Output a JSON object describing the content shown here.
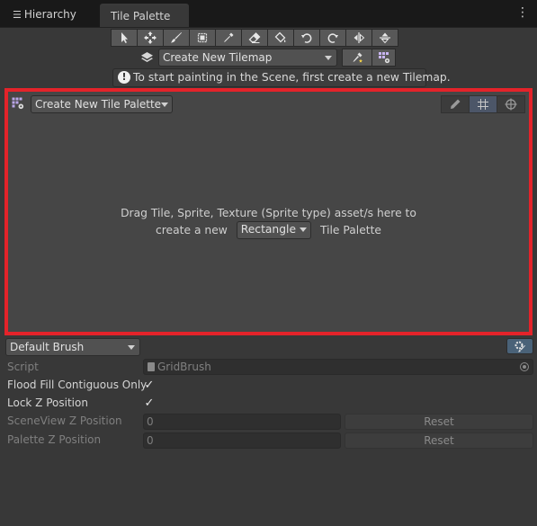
{
  "tabs": {
    "hierarchy_label": "Hierarchy",
    "tile_palette_label": "Tile Palette"
  },
  "toolbar": {
    "tools": [
      {
        "name": "select-tool",
        "icon": "select-arrow-icon"
      },
      {
        "name": "move-tool",
        "icon": "move-icon"
      },
      {
        "name": "paint-tool",
        "icon": "brush-icon"
      },
      {
        "name": "box-fill-tool",
        "icon": "box-fill-icon"
      },
      {
        "name": "pick-tool",
        "icon": "eyedropper-icon"
      },
      {
        "name": "erase-tool",
        "icon": "eraser-icon"
      },
      {
        "name": "fill-tool",
        "icon": "bucket-icon"
      },
      {
        "name": "rotate-ccw-tool",
        "icon": "rotate-ccw-icon"
      },
      {
        "name": "rotate-cw-tool",
        "icon": "rotate-cw-icon"
      },
      {
        "name": "flip-x-tool",
        "icon": "flip-x-icon"
      },
      {
        "name": "flip-y-tool",
        "icon": "flip-y-icon"
      }
    ]
  },
  "active_tilemap": {
    "selected": "Create New Tilemap"
  },
  "warning": {
    "text": "To start painting in the Scene, first create a new Tilemap."
  },
  "palette": {
    "selected": "Create New Tile Palette",
    "drop_message_line1": "Drag Tile, Sprite, Texture (Sprite type) asset/s here to",
    "drop_message_prefix": "create a new",
    "drop_shape": "Rectangle",
    "drop_message_suffix": "Tile Palette"
  },
  "brush": {
    "selected": "Default Brush",
    "properties": {
      "script_label": "Script",
      "script_value": "GridBrush",
      "flood_fill_label": "Flood Fill Contiguous Only",
      "flood_fill_checked": true,
      "lock_z_label": "Lock Z Position",
      "lock_z_checked": true,
      "sceneview_z_label": "SceneView Z Position",
      "sceneview_z_value": "0",
      "palette_z_label": "Palette Z Position",
      "palette_z_value": "0",
      "reset_label": "Reset",
      "check_glyph": "✓"
    }
  },
  "colors": {
    "highlight_border": "#e4232a",
    "panel_bg": "#383838",
    "palette_bg": "#464646"
  }
}
